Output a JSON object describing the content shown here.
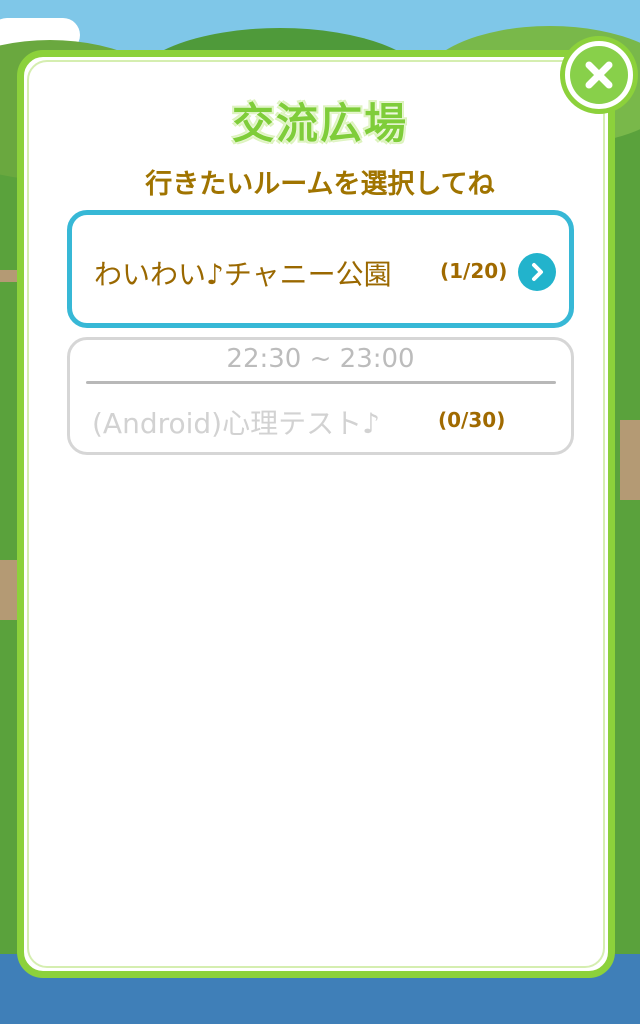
{
  "dialog": {
    "title": "交流広場",
    "subtitle": "行きたいルームを選択してね",
    "close_icon": "close-icon"
  },
  "rooms": [
    {
      "name": "わいわい♪チャニー公園",
      "count": "(1/20)",
      "enabled": true,
      "icon": "chevron-right-icon"
    },
    {
      "time": "22:30 ~ 23:00",
      "name": "(Android)心理テスト♪",
      "count": "(0/30)",
      "enabled": false
    }
  ],
  "colors": {
    "accent_green": "#8cd13b",
    "active_border": "#37b8d6",
    "text_brown": "#a07400"
  }
}
